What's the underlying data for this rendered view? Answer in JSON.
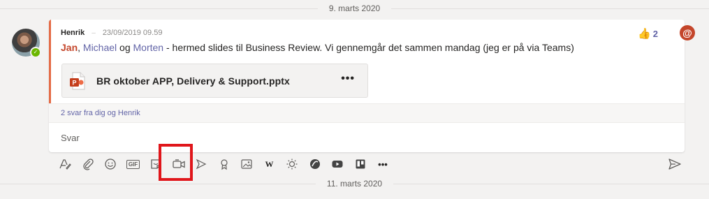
{
  "dividers": {
    "top_date": "9. marts 2020",
    "bottom_date": "11. marts 2020"
  },
  "message": {
    "author": "Henrik",
    "separator": "–",
    "timestamp": "23/09/2019 09.59",
    "mentions": [
      "Jan",
      "Michael",
      "Morten"
    ],
    "conj_comma": ",",
    "conj_og": "og",
    "text": " - hermed slides til Business Review. Vi gennemgår det sammen mandag (jeg er på via Teams)",
    "attachment": {
      "file_name": "BR oktober APP, Delivery & Support.pptx",
      "more_label": "•••",
      "icon": "powerpoint-file-icon"
    },
    "reactions": {
      "icon": "thumbs-up-icon",
      "emoji": "👍",
      "count": "2"
    },
    "mention_badge": "@",
    "replies_link": "2 svar fra dig og Henrik",
    "reply_placeholder": "Svar"
  },
  "toolbar": {
    "items": [
      "format-icon",
      "attach-icon",
      "emoji-icon",
      "gif-icon",
      "sticker-icon",
      "meet-now-icon",
      "stream-icon",
      "praise-icon",
      "image-icon",
      "wiki-icon",
      "weather-icon",
      "app-icon",
      "youtube-icon",
      "trello-icon",
      "more-options-icon"
    ],
    "gif_label": "GIF",
    "wiki_label": "W",
    "more_label": "•••",
    "send_icon": "send-icon"
  },
  "colors": {
    "accent": "#e46a44",
    "mention_self": "#c4462b",
    "mention": "#6264a7",
    "highlight": "#e0161b",
    "presence": "#6bb700"
  }
}
